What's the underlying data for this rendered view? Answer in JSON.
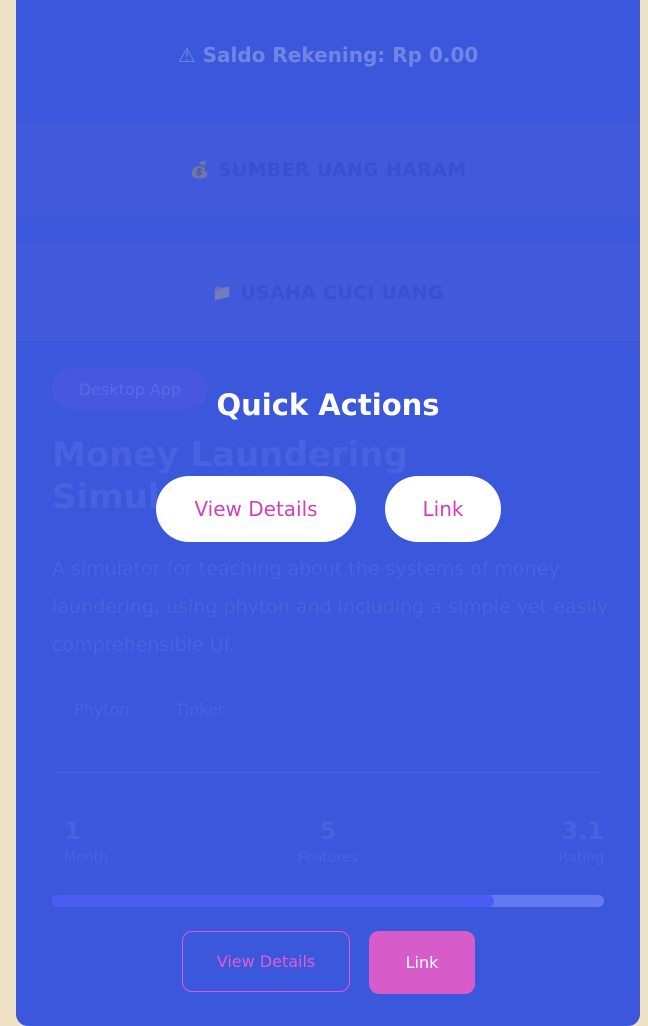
{
  "saldo": {
    "icon": "warning-icon",
    "text": "⚠ Saldo Rekening: Rp 0.00"
  },
  "sections": [
    {
      "icon": "bag-icon",
      "glyph": "💰",
      "label": "SUMBER UANG HARAM"
    },
    {
      "icon": "folder-icon",
      "glyph": "📁",
      "label": "USAHA CUCI UANG"
    }
  ],
  "project": {
    "category": "Desktop App",
    "title": "Money Laundering Simulation App",
    "description": "A simulator for teaching about the systems of money laundering, using phyton and including a simple yet easily comprehensible UI.",
    "tags": [
      "Phyton",
      "Tinker"
    ],
    "stats": [
      {
        "value": "1",
        "label": "Month"
      },
      {
        "value": "5",
        "label": "Features"
      },
      {
        "value": "3.1",
        "label": "Rating"
      }
    ],
    "progress": 0.8,
    "actions": {
      "details": "View Details",
      "link": "Link"
    }
  },
  "overlay": {
    "title": "Quick Actions",
    "details": "View Details",
    "link": "Link"
  },
  "colors": {
    "card": "#3b57dc",
    "accent": "#d75bc9",
    "background": "#efe1c5"
  }
}
